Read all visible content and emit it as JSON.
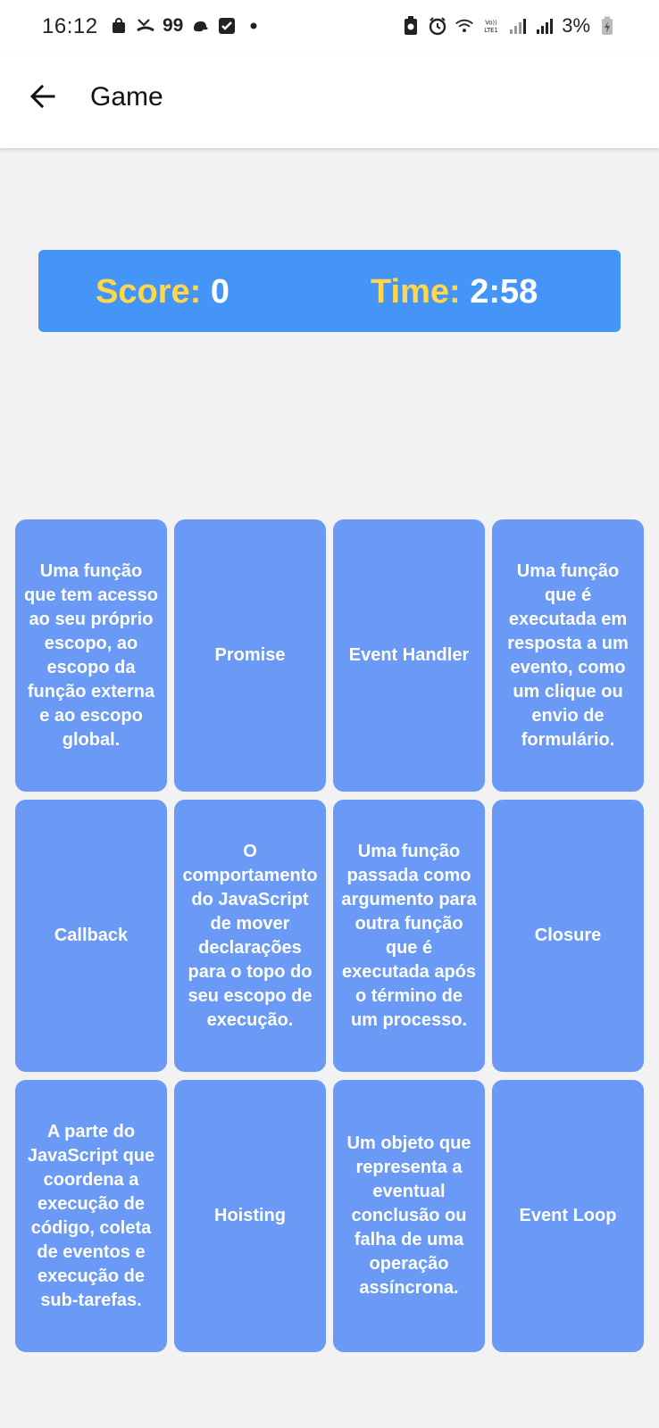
{
  "status_bar": {
    "time": "16:12",
    "left_icons": [
      "shopping-bag-icon",
      "missed-call-icon",
      "99",
      "notification-app-icon",
      "checkbox-icon",
      "dot-icon"
    ],
    "battery": "3%"
  },
  "app_bar": {
    "title": "Game"
  },
  "scoreboard": {
    "score_label": "Score:",
    "score_value": "0",
    "time_label": "Time:",
    "time_value": "2:58"
  },
  "cards": [
    {
      "text": "Uma função que tem acesso ao seu próprio escopo, ao escopo da função externa e ao escopo global."
    },
    {
      "text": "Promise"
    },
    {
      "text": "Event Handler"
    },
    {
      "text": "Uma função que é executada em resposta a um evento, como um clique ou envio de formulário."
    },
    {
      "text": "Callback"
    },
    {
      "text": "O comportamento do JavaScript de mover declarações para o topo do seu escopo de execução."
    },
    {
      "text": "Uma função passada como argumento para outra função que é executada após o término de um processo."
    },
    {
      "text": "Closure"
    },
    {
      "text": "A parte do JavaScript que coordena a execução de código, coleta de eventos e execução de sub-tarefas."
    },
    {
      "text": "Hoisting"
    },
    {
      "text": "Um objeto que representa a eventual conclusão ou falha de uma operação assíncrona."
    },
    {
      "text": "Event Loop"
    }
  ],
  "colors": {
    "scoreboard_bg": "#4594f8",
    "label_yellow": "#ffd84a",
    "card_bg": "#6a99f6"
  }
}
